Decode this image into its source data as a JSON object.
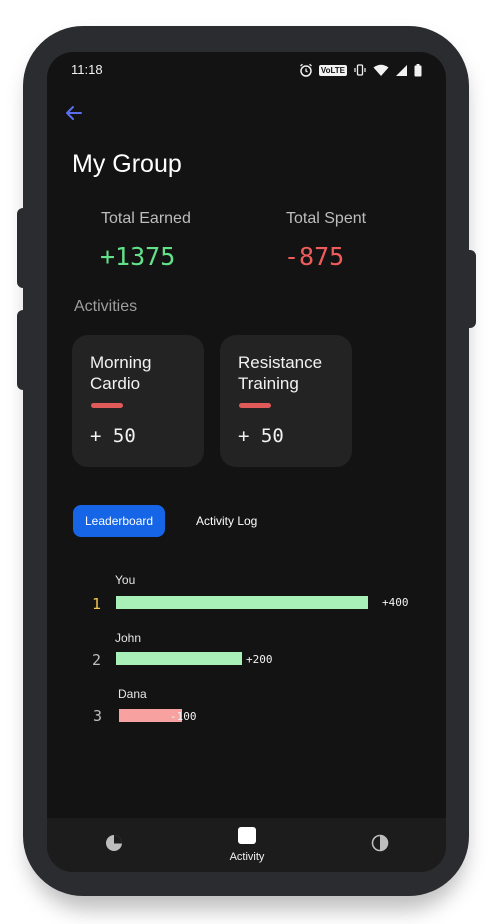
{
  "status_bar": {
    "time": "11:18",
    "volte": "VoLTE"
  },
  "header": {
    "title": "My Group"
  },
  "stats": {
    "earned": {
      "label": "Total Earned",
      "value": "+1375"
    },
    "spent": {
      "label": "Total Spent",
      "value": "-875"
    }
  },
  "activities": {
    "label": "Activities",
    "items": [
      {
        "name": "Morning\nCardio",
        "points": "+ 50"
      },
      {
        "name": "Resistance\nTraining",
        "points": "+ 50"
      }
    ]
  },
  "tabs": [
    {
      "label": "Leaderboard",
      "active": true
    },
    {
      "label": "Activity Log",
      "active": false
    }
  ],
  "leaderboard": [
    {
      "rank": "1",
      "name": "You",
      "score": "+400",
      "points": 400
    },
    {
      "rank": "2",
      "name": "John",
      "score": "+200",
      "points": 200
    },
    {
      "rank": "3",
      "name": "Dana",
      "score": "-100",
      "points": -100
    }
  ],
  "bottom_nav": [
    {
      "icon": "pie-chart-icon",
      "label": ""
    },
    {
      "icon": "square-icon",
      "label": "Activity"
    },
    {
      "icon": "contrast-icon",
      "label": ""
    }
  ],
  "colors": {
    "accent": "#1565e6",
    "positive": "#62e08a",
    "negative": "#ee5b5b",
    "bar_positive": "#a8f0b8",
    "bar_negative": "#f7a1a1",
    "rank_first": "#f3c64b"
  }
}
